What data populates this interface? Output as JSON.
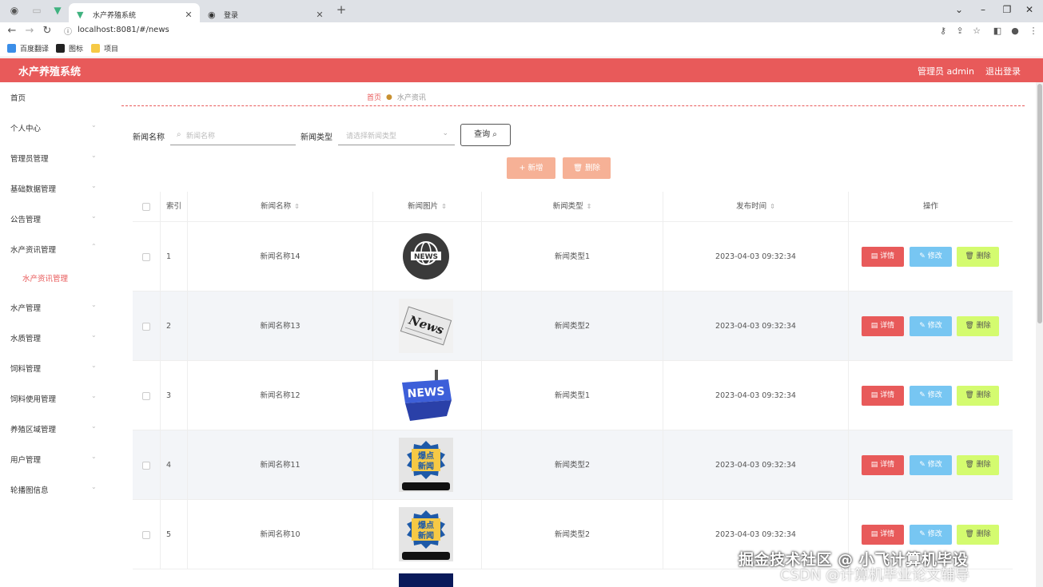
{
  "browser": {
    "tabs": [
      {
        "title": "水产养殖系统",
        "active": true
      },
      {
        "title": "登录",
        "active": false
      }
    ],
    "url": "localhost:8081/#/news",
    "bookmarks": [
      "百度翻译",
      "图标",
      "项目"
    ]
  },
  "header": {
    "title": "水产养殖系统",
    "admin_label": "管理员 admin",
    "logout_label": "退出登录",
    "accent": "#e85a5a"
  },
  "sidebar": {
    "items": [
      {
        "label": "首页"
      },
      {
        "label": "个人中心"
      },
      {
        "label": "管理员管理"
      },
      {
        "label": "基础数据管理"
      },
      {
        "label": "公告管理"
      },
      {
        "label": "水产资讯管理"
      },
      {
        "label": "水产管理"
      },
      {
        "label": "水质管理"
      },
      {
        "label": "饲料管理"
      },
      {
        "label": "饲料使用管理"
      },
      {
        "label": "养殖区域管理"
      },
      {
        "label": "用户管理"
      },
      {
        "label": "轮播图信息"
      }
    ],
    "active_sub": "水产资讯管理"
  },
  "breadcrumb": {
    "home": "首页",
    "current": "水产资讯"
  },
  "search": {
    "name_label": "新闻名称",
    "name_placeholder": "新闻名称",
    "type_label": "新闻类型",
    "type_placeholder": "请选择新闻类型",
    "query_label": "查询"
  },
  "actions": {
    "add_label": "新增",
    "delete_label": "删除"
  },
  "table": {
    "headers": {
      "index": "索引",
      "name": "新闻名称",
      "image": "新闻图片",
      "type": "新闻类型",
      "time": "发布时间",
      "ops": "操作"
    },
    "op_labels": {
      "detail": "详情",
      "edit": "修改",
      "delete": "删除"
    },
    "rows": [
      {
        "index": "1",
        "name": "新闻名称14",
        "type": "新闻类型1",
        "time": "2023-04-03 09:32:34",
        "thumb": "news-globe"
      },
      {
        "index": "2",
        "name": "新闻名称13",
        "type": "新闻类型2",
        "time": "2023-04-03 09:32:34",
        "thumb": "news-paper"
      },
      {
        "index": "3",
        "name": "新闻名称12",
        "type": "新闻类型1",
        "time": "2023-04-03 09:32:34",
        "thumb": "news-key"
      },
      {
        "index": "4",
        "name": "新闻名称11",
        "type": "新闻类型2",
        "time": "2023-04-03 09:32:34",
        "thumb": "hot-news"
      },
      {
        "index": "5",
        "name": "新闻名称10",
        "type": "新闻类型2",
        "time": "2023-04-03 09:32:34",
        "thumb": "hot-news"
      }
    ]
  },
  "watermark": {
    "line1": "掘金技术社区 @ 小飞计算机毕设",
    "line2": "CSDN @计算机毕业论文辅导"
  }
}
